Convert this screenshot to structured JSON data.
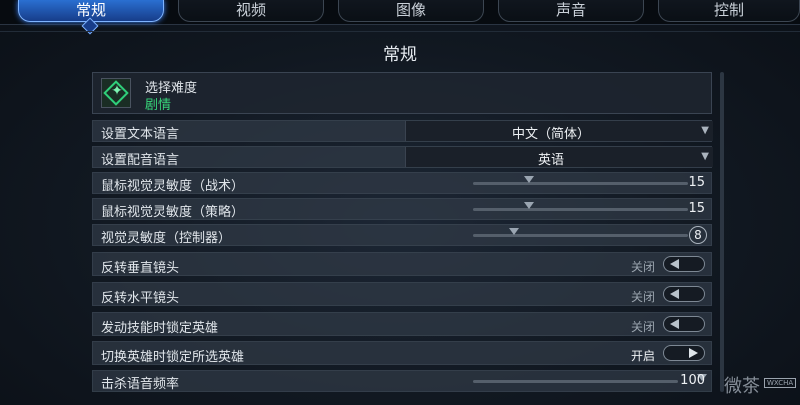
{
  "tabs": [
    "常规",
    "视频",
    "图像",
    "声音",
    "控制"
  ],
  "page_title": "常规",
  "difficulty": {
    "label": "选择难度",
    "value": "剧情"
  },
  "settings": {
    "text_language": {
      "label": "设置文本语言",
      "value": "中文（简体）"
    },
    "voice_language": {
      "label": "设置配音语言",
      "value": "英语"
    },
    "mouse_tactical": {
      "label": "鼠标视觉灵敏度（战术）",
      "value": "15",
      "level": 0.15
    },
    "mouse_strategy": {
      "label": "鼠标视觉灵敏度（策略）",
      "value": "15",
      "level": 0.15
    },
    "controller": {
      "label": "视觉灵敏度（控制器）",
      "value": "8",
      "level": 0.08
    },
    "invert_vertical": {
      "label": "反转垂直镜头",
      "state": "关闭"
    },
    "invert_horizontal": {
      "label": "反转水平镜头",
      "state": "关闭"
    },
    "lock_hero_skill": {
      "label": "发动技能时锁定英雄",
      "state": "关闭"
    },
    "lock_selected_hero": {
      "label": "切换英雄时锁定所选英雄",
      "state": "开启"
    },
    "kill_voice_freq": {
      "label": "击杀语音频率",
      "value": "100",
      "level": 1.0
    }
  },
  "watermark": {
    "text": "微茶",
    "badge": "WXCHA"
  },
  "colors": {
    "accent": "#2a6fd1",
    "difficulty": "#37d67a"
  }
}
